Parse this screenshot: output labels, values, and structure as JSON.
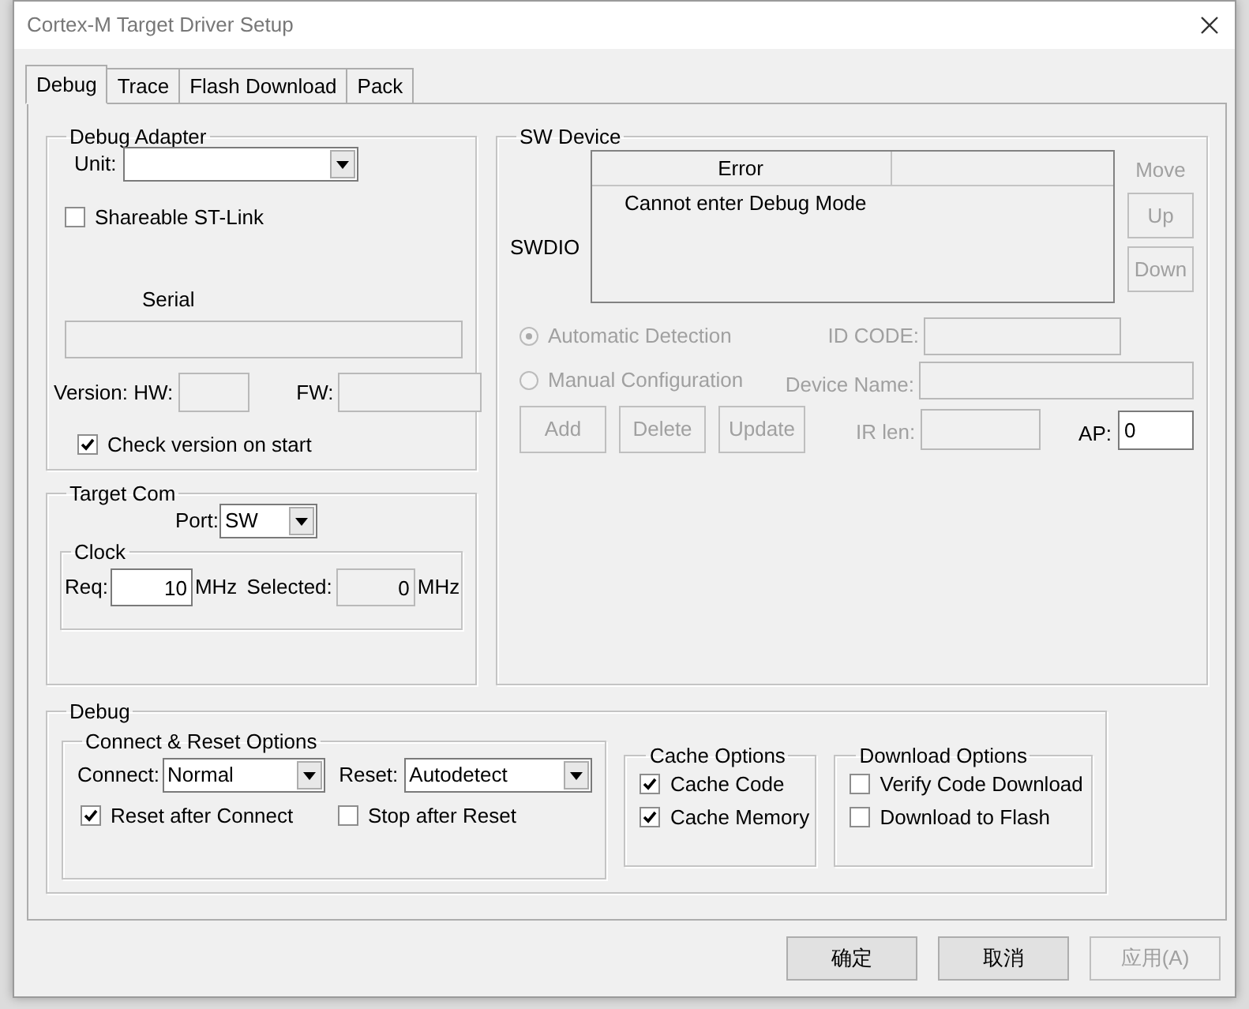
{
  "window": {
    "title": "Cortex-M Target Driver Setup"
  },
  "tabs": [
    {
      "label": "Debug",
      "selected": true
    },
    {
      "label": "Trace",
      "selected": false
    },
    {
      "label": "Flash Download",
      "selected": false
    },
    {
      "label": "Pack",
      "selected": false
    }
  ],
  "debug_adapter": {
    "title": "Debug Adapter",
    "unit_label": "Unit:",
    "shareable": {
      "label": "Shareable ST-Link",
      "checked": false
    },
    "serial_label": "Serial",
    "hw_label": "Version: HW:",
    "fw_label": "FW:",
    "check_version": {
      "label": "Check version on start",
      "checked": true
    }
  },
  "target_com": {
    "title": "Target Com",
    "port_label": "Port:",
    "port_value": "SW",
    "clock": {
      "title": "Clock",
      "req_label": "Req:",
      "req_value": "10",
      "req_unit": "MHz",
      "selected_label": "Selected:",
      "selected_value": "0",
      "selected_unit": "MHz"
    }
  },
  "sw_device": {
    "title": "SW Device",
    "row_label": "SWDIO",
    "columns": [
      "Error"
    ],
    "rows": [
      [
        "Cannot enter Debug Mode"
      ]
    ],
    "move_label": "Move",
    "move_buttons": [
      {
        "label": "Up",
        "disabled": true
      },
      {
        "label": "Down",
        "disabled": true
      }
    ],
    "detection": [
      {
        "label": "Automatic Detection",
        "selected": true,
        "disabled": true
      },
      {
        "label": "Manual Configuration",
        "selected": false,
        "disabled": true
      }
    ],
    "id_code_label": "ID CODE:",
    "device_name_label": "Device Name:",
    "ir_len_label": "IR len:",
    "ap_label": "AP:",
    "ap_value": "0",
    "buttons": [
      {
        "label": "Add",
        "disabled": true
      },
      {
        "label": "Delete",
        "disabled": true
      },
      {
        "label": "Update",
        "disabled": true
      }
    ]
  },
  "debug": {
    "title": "Debug",
    "connect_reset": {
      "title": "Connect & Reset Options",
      "connect_label": "Connect:",
      "connect_value": "Normal",
      "reset_label": "Reset:",
      "reset_value": "Autodetect",
      "options": [
        {
          "label": "Reset after Connect",
          "checked": true
        },
        {
          "label": "Stop after Reset",
          "checked": false
        }
      ]
    },
    "cache": {
      "title": "Cache Options",
      "options": [
        {
          "label": "Cache Code",
          "checked": true
        },
        {
          "label": "Cache Memory",
          "checked": true
        }
      ]
    },
    "download": {
      "title": "Download Options",
      "options": [
        {
          "label": "Verify Code Download",
          "checked": false
        },
        {
          "label": "Download to Flash",
          "checked": false
        }
      ]
    }
  },
  "buttons": [
    {
      "label": "确定",
      "disabled": false
    },
    {
      "label": "取消",
      "disabled": false
    },
    {
      "label": "应用(A)",
      "disabled": true
    }
  ]
}
